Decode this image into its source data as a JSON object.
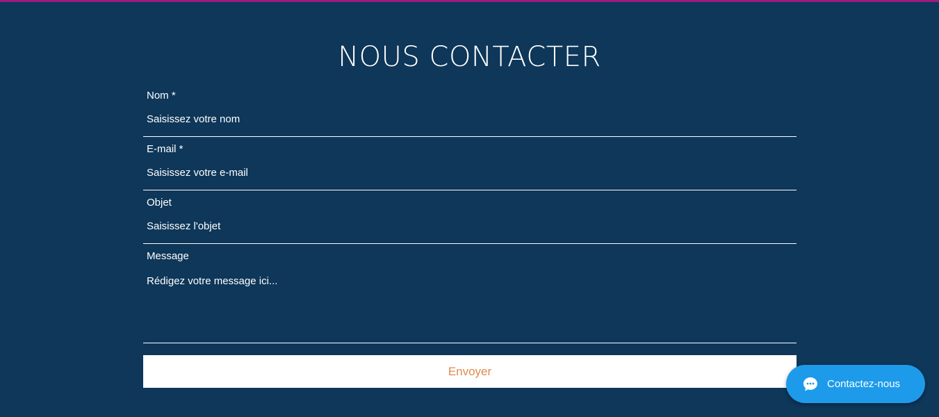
{
  "colors": {
    "background": "#0e3759",
    "top_strip": "#9b1b7f",
    "submit_background": "#ffffff",
    "submit_text": "#e08a4f",
    "chat_button": "#1d9bea"
  },
  "page": {
    "title": "NOUS CONTACTER"
  },
  "form": {
    "name": {
      "label": "Nom *",
      "placeholder": "Saisissez votre nom",
      "value": ""
    },
    "email": {
      "label": "E-mail *",
      "placeholder": "Saisissez votre e-mail",
      "value": ""
    },
    "subject": {
      "label": "Objet",
      "placeholder": "Saisissez l'objet",
      "value": ""
    },
    "message": {
      "label": "Message",
      "placeholder": "Rédigez votre message ici...",
      "value": ""
    },
    "submit_label": "Envoyer"
  },
  "chat_widget": {
    "label": "Contactez-nous",
    "icon": "chat-bubble-icon"
  }
}
